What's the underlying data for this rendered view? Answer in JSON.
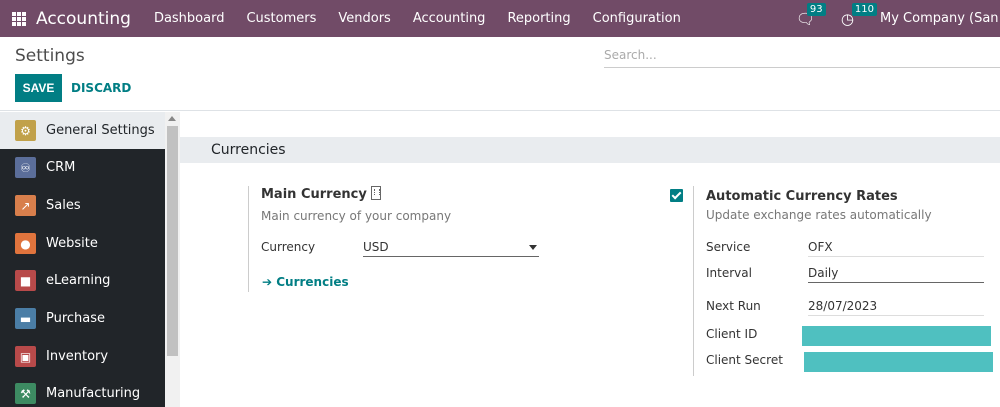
{
  "navbar": {
    "brand": "Accounting",
    "menu": [
      "Dashboard",
      "Customers",
      "Vendors",
      "Accounting",
      "Reporting",
      "Configuration"
    ],
    "messages_count": "93",
    "activities_count": "110",
    "company": "My Company (San Fra"
  },
  "control": {
    "title": "Settings",
    "search_placeholder": "Search...",
    "save_label": "SAVE",
    "discard_label": "DISCARD"
  },
  "sidebar": {
    "items": [
      {
        "label": "General Settings",
        "icon": "gear-icon",
        "color": "#c1a14a"
      },
      {
        "label": "CRM",
        "icon": "handshake-icon",
        "color": "#5b6e9a"
      },
      {
        "label": "Sales",
        "icon": "chart-icon",
        "color": "#d87f4c"
      },
      {
        "label": "Website",
        "icon": "globe-icon",
        "color": "#e0743d"
      },
      {
        "label": "eLearning",
        "icon": "elearning-icon",
        "color": "#b84a4a"
      },
      {
        "label": "Purchase",
        "icon": "card-icon",
        "color": "#4b7ea6"
      },
      {
        "label": "Inventory",
        "icon": "box-icon",
        "color": "#b84a4a"
      },
      {
        "label": "Manufacturing",
        "icon": "wrench-icon",
        "color": "#3d8b62"
      }
    ]
  },
  "section": {
    "title": "Currencies"
  },
  "main_currency": {
    "title": "Main Currency",
    "description": "Main currency of your company",
    "currency_label": "Currency",
    "currency_value": "USD",
    "link_label": "Currencies"
  },
  "auto_rates": {
    "enabled": true,
    "title": "Automatic Currency Rates",
    "description": "Update exchange rates automatically",
    "service_label": "Service",
    "service_value": "OFX",
    "interval_label": "Interval",
    "interval_value": "Daily",
    "next_run_label": "Next Run",
    "next_run_value": "28/07/2023",
    "client_id_label": "Client ID",
    "client_secret_label": "Client Secret"
  },
  "colors": {
    "navbar": "#714b67",
    "accent": "#017e84",
    "redacted": "#4fc0c0"
  }
}
